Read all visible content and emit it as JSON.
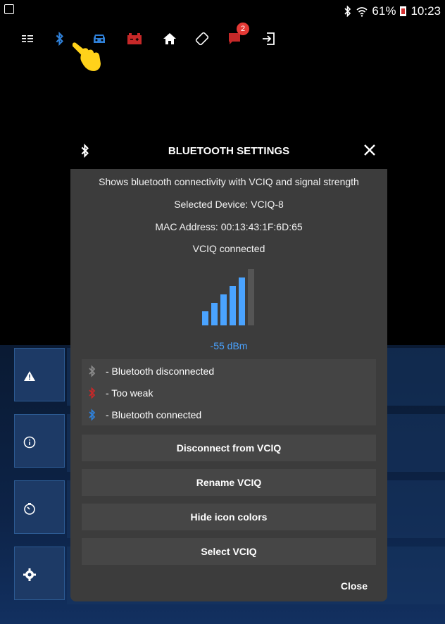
{
  "status_bar": {
    "battery": "61%",
    "time": "10:23"
  },
  "toolbar": {
    "icons": [
      "menu-icon",
      "bluetooth-icon",
      "car-icon",
      "battery-icon",
      "home-icon",
      "rotate-icon",
      "notifications-icon",
      "exit-icon"
    ],
    "notifications_count": "2"
  },
  "dialog": {
    "title": "BLUETOOTH SETTINGS",
    "description": "Shows bluetooth connectivity with VCIQ and signal strength",
    "selected_device": "Selected Device: VCIQ-8",
    "mac_address": "MAC Address: 00:13:43:1F:6D:65",
    "status": "VCIQ connected",
    "signal_strength": "-55 dBm",
    "signal_bars_filled": 5,
    "signal_bars_total": 6,
    "legend": [
      {
        "label": "- Bluetooth disconnected",
        "color": "#8a8a8a"
      },
      {
        "label": "- Too weak",
        "color": "#c62828"
      },
      {
        "label": "- Bluetooth connected",
        "color": "#2f80d8"
      }
    ],
    "buttons": {
      "disconnect": "Disconnect from VCIQ",
      "rename": "Rename VCIQ",
      "hide_colors": "Hide icon colors",
      "select": "Select VCIQ"
    },
    "close_label": "Close"
  },
  "colors": {
    "dialog_bg": "#3c3c3c",
    "accent_blue": "#4aa3ff",
    "tile_blue": "#1d3a66"
  }
}
